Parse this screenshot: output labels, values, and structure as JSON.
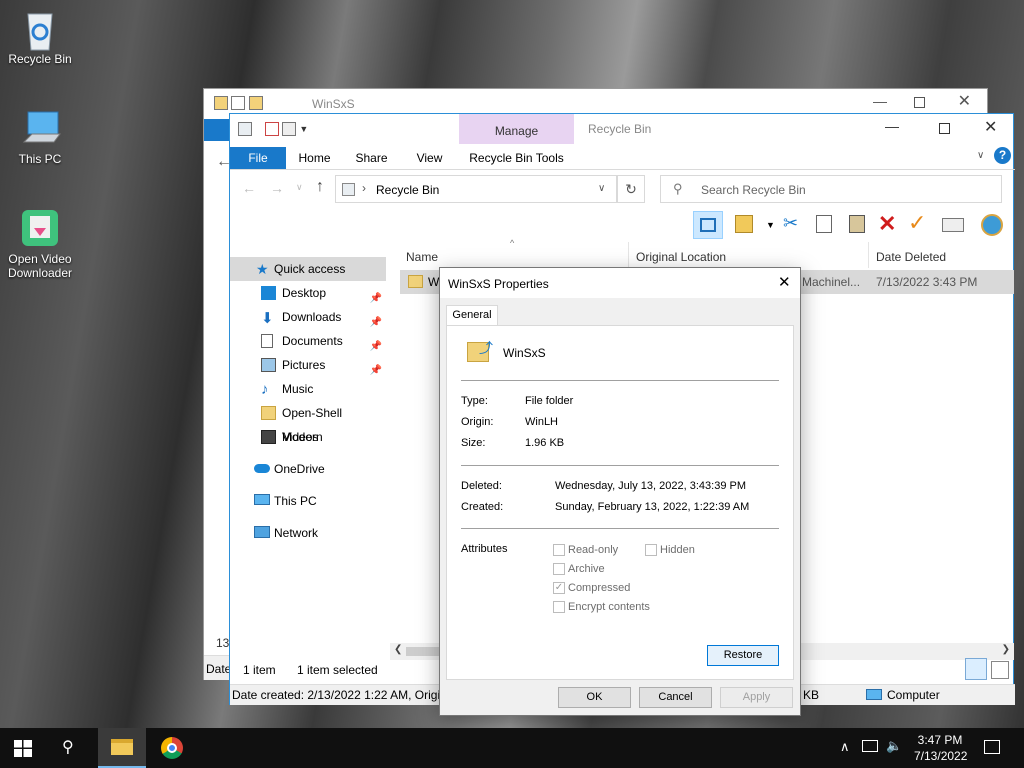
{
  "desktop": {
    "icons": [
      {
        "label": "Recycle Bin"
      },
      {
        "label": "This PC"
      },
      {
        "label": "Open Video Downloader"
      }
    ]
  },
  "back_window": {
    "title": "WinSxS",
    "status_left": "Date",
    "left_number": "13"
  },
  "front_window": {
    "title": "Recycle Bin",
    "contextual_tab": "Manage",
    "ribbon_tabs": [
      "File",
      "Home",
      "Share",
      "View",
      "Recycle Bin Tools"
    ],
    "address": "Recycle Bin",
    "search_placeholder": "Search Recycle Bin",
    "nav": {
      "quick_access": "Quick access",
      "items": [
        "Desktop",
        "Downloads",
        "Documents",
        "Pictures",
        "Music",
        "Open-Shell Modern",
        "Videos"
      ],
      "onedrive": "OneDrive",
      "this_pc": "This PC",
      "network": "Network"
    },
    "columns": {
      "name": "Name",
      "original_location": "Original Location",
      "date_deleted": "Date Deleted"
    },
    "row": {
      "name": "W",
      "location": "Machinel...",
      "date": "7/13/2022 3:43 PM"
    },
    "status": {
      "items": "1 item",
      "selected": "1 item selected"
    },
    "details_bar": {
      "text": "Date created: 2/13/2022 1:22 AM, Origin",
      "size": "KB",
      "computer": "Computer"
    }
  },
  "dialog": {
    "title": "WinSxS Properties",
    "tab": "General",
    "name": "WinSxS",
    "type_label": "Type:",
    "type_value": "File folder",
    "origin_label": "Origin:",
    "origin_value": "WinLH",
    "size_label": "Size:",
    "size_value": "1.96 KB",
    "deleted_label": "Deleted:",
    "deleted_value": "Wednesday, July 13, 2022, 3:43:39 PM",
    "created_label": "Created:",
    "created_value": "Sunday, February 13, 2022, 1:22:39 AM",
    "attributes_label": "Attributes",
    "attributes": {
      "readonly": "Read-only",
      "hidden": "Hidden",
      "archive": "Archive",
      "compressed": "Compressed",
      "encrypt": "Encrypt contents"
    },
    "restore": "Restore",
    "ok": "OK",
    "cancel": "Cancel",
    "apply": "Apply"
  },
  "taskbar": {
    "time": "3:47 PM",
    "date": "7/13/2022"
  },
  "colors": {
    "accent": "#1979ca",
    "manage_tab": "#e8d4f2",
    "selection": "#cce8ff"
  }
}
